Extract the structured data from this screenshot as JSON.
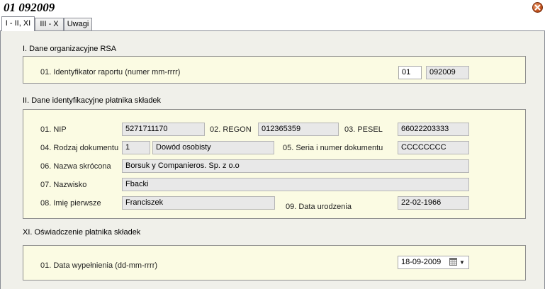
{
  "window": {
    "title": "01 092009"
  },
  "tabs": [
    {
      "label": "I - II, XI",
      "active": true
    },
    {
      "label": "III - X",
      "active": false
    },
    {
      "label": "Uwagi",
      "active": false
    }
  ],
  "sections": {
    "s1": {
      "title": "I. Dane organizacyjne RSA",
      "id_label": "01. Identyfikator raportu (numer mm-rrrr)",
      "id_number": "01",
      "id_period": "092009"
    },
    "s2": {
      "title": "II. Dane identyfikacyjne płatnika składek",
      "nip_label": "01. NIP",
      "nip": "5271711170",
      "regon_label": "02. REGON",
      "regon": "012365359",
      "pesel_label": "03. PESEL",
      "pesel": "66022203333",
      "doc_type_label": "04. Rodzaj dokumentu",
      "doc_type_code": "1",
      "doc_type_name": "Dowód osobisty",
      "doc_series_label": "05. Seria i numer dokumentu",
      "doc_series": "CCCCCCCC",
      "short_name_label": "06. Nazwa skrócona",
      "short_name": "Borsuk y Companieros. Sp. z o.o",
      "surname_label": "07. Nazwisko",
      "surname": "Fbacki",
      "first_name_label": "08. Imię pierwsze",
      "first_name": "Franciszek",
      "birth_date_label": "09. Data urodzenia",
      "birth_date": "22-02-1966"
    },
    "s3": {
      "title": "XI. Oświadczenie płatnika składek",
      "fill_date_label": "01. Data wypełnienia (dd-mm-rrrr)",
      "fill_date": "18-09-2009"
    }
  },
  "icons": {
    "close": "close-icon",
    "calendar": "calendar-icon",
    "dropdown": "chevron-down-icon"
  },
  "colors": {
    "panel_bg": "#fbfbe3",
    "content_bg": "#f0f0ea",
    "field_bg": "#e8e8e8",
    "close_button": "#c0501c"
  }
}
